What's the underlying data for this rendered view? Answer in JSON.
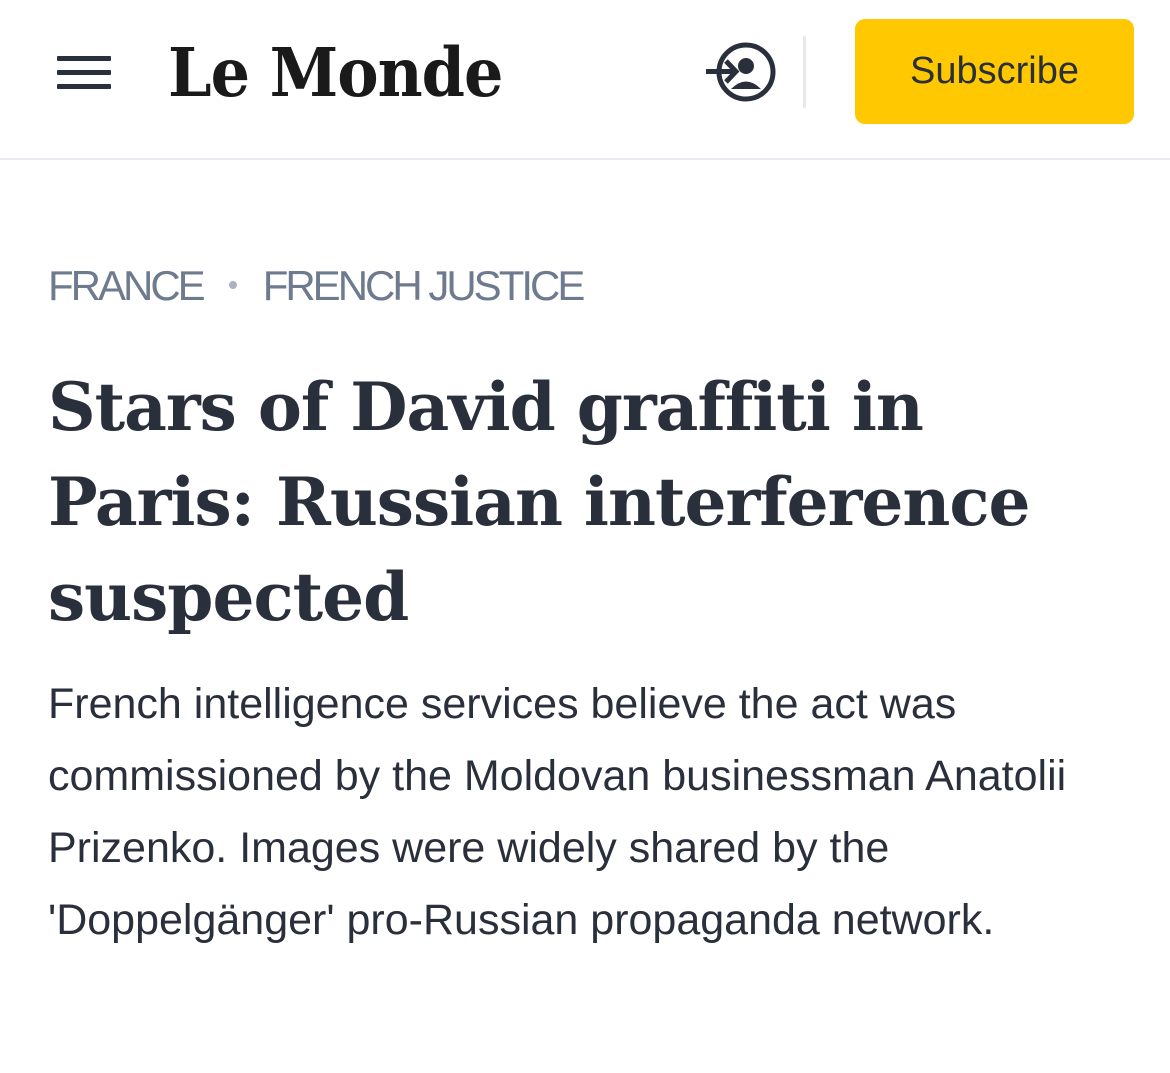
{
  "header": {
    "logo_text": "Le Monde",
    "subscribe_label": "Subscribe"
  },
  "breadcrumb": {
    "section": "FRANCE",
    "subsection": "FRENCH JUSTICE"
  },
  "article": {
    "headline": "Stars of David graffiti in Paris: Russian interference suspected",
    "dek": "French intelligence services believe the act was commissioned by the Moldovan businessman Anatolii Prizenko. Images were widely shared by the 'Doppelgänger' pro-Russian propaganda network."
  },
  "colors": {
    "accent": "#ffc800",
    "text": "#2a303b",
    "breadcrumb": "#6e7b8f"
  },
  "icons": [
    "menu-icon",
    "login-icon"
  ]
}
